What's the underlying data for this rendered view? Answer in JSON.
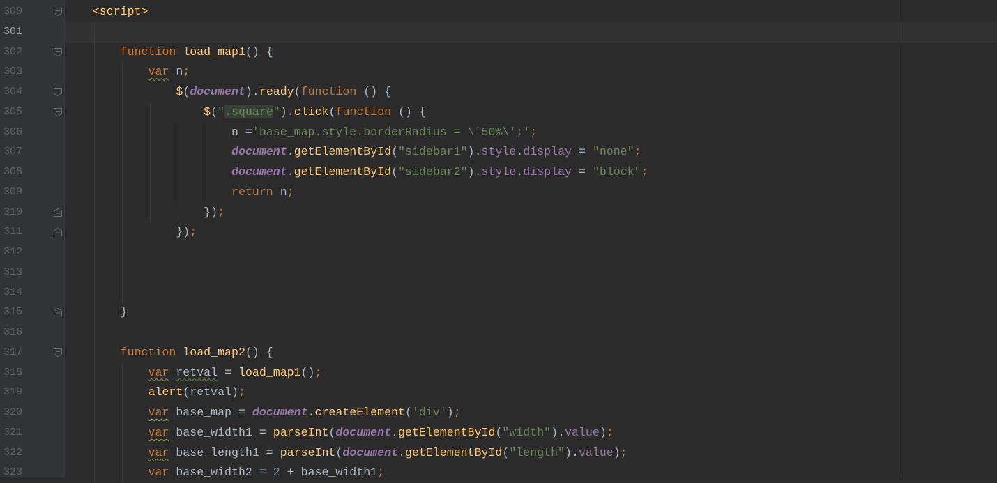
{
  "editor": {
    "current_line": "301",
    "lines": [
      {
        "num": "300",
        "fold": "open",
        "tokens": [
          [
            "t",
            "    "
          ],
          [
            "f",
            "<script>"
          ]
        ]
      },
      {
        "num": "301",
        "fold": "",
        "tokens": []
      },
      {
        "num": "302",
        "fold": "open",
        "tokens": [
          [
            "t",
            "        "
          ],
          [
            "k",
            "function "
          ],
          [
            "f",
            "load_map1"
          ],
          [
            "t",
            "() {"
          ]
        ]
      },
      {
        "num": "303",
        "fold": "",
        "tokens": [
          [
            "t",
            "            "
          ],
          [
            "k w",
            "var"
          ],
          [
            "t",
            " n"
          ],
          [
            "k",
            ";"
          ]
        ]
      },
      {
        "num": "304",
        "fold": "open",
        "tokens": [
          [
            "t",
            "                "
          ],
          [
            "f",
            "$"
          ],
          [
            "t",
            "("
          ],
          [
            "pi",
            "document"
          ],
          [
            "t",
            ")."
          ],
          [
            "f",
            "ready"
          ],
          [
            "t",
            "("
          ],
          [
            "k",
            "function "
          ],
          [
            "t",
            "() {"
          ]
        ]
      },
      {
        "num": "305",
        "fold": "open",
        "tokens": [
          [
            "t",
            "                    "
          ],
          [
            "f",
            "$"
          ],
          [
            "t",
            "("
          ],
          [
            "s",
            "\""
          ],
          [
            "s hl",
            ".square"
          ],
          [
            "s",
            "\""
          ],
          [
            "t",
            ")."
          ],
          [
            "f",
            "click"
          ],
          [
            "t",
            "("
          ],
          [
            "k",
            "function "
          ],
          [
            "t",
            "() {"
          ]
        ]
      },
      {
        "num": "306",
        "fold": "",
        "tokens": [
          [
            "t",
            "                        n ="
          ],
          [
            "s",
            "'base_map.style.borderRadius = \\'50%\\';'"
          ],
          [
            "k",
            ";"
          ]
        ]
      },
      {
        "num": "307",
        "fold": "",
        "tokens": [
          [
            "t",
            "                        "
          ],
          [
            "pi",
            "document"
          ],
          [
            "t",
            "."
          ],
          [
            "f",
            "getElementById"
          ],
          [
            "t",
            "("
          ],
          [
            "s",
            "\"sidebar1\""
          ],
          [
            "t",
            ")."
          ],
          [
            "p",
            "style"
          ],
          [
            "t",
            "."
          ],
          [
            "p",
            "display"
          ],
          [
            "t",
            " = "
          ],
          [
            "s",
            "\"none\""
          ],
          [
            "k",
            ";"
          ]
        ]
      },
      {
        "num": "308",
        "fold": "",
        "tokens": [
          [
            "t",
            "                        "
          ],
          [
            "pi",
            "document"
          ],
          [
            "t",
            "."
          ],
          [
            "f",
            "getElementById"
          ],
          [
            "t",
            "("
          ],
          [
            "s",
            "\"sidebar2\""
          ],
          [
            "t",
            ")."
          ],
          [
            "p",
            "style"
          ],
          [
            "t",
            "."
          ],
          [
            "p",
            "display"
          ],
          [
            "t",
            " = "
          ],
          [
            "s",
            "\"block\""
          ],
          [
            "k",
            ";"
          ]
        ]
      },
      {
        "num": "309",
        "fold": "",
        "tokens": [
          [
            "t",
            "                        "
          ],
          [
            "k",
            "return "
          ],
          [
            "t",
            "n"
          ],
          [
            "k",
            ";"
          ]
        ]
      },
      {
        "num": "310",
        "fold": "close",
        "tokens": [
          [
            "t",
            "                    })"
          ],
          [
            "k",
            ";"
          ]
        ]
      },
      {
        "num": "311",
        "fold": "close",
        "tokens": [
          [
            "t",
            "                })"
          ],
          [
            "k",
            ";"
          ]
        ]
      },
      {
        "num": "312",
        "fold": "",
        "tokens": []
      },
      {
        "num": "313",
        "fold": "",
        "tokens": []
      },
      {
        "num": "314",
        "fold": "",
        "tokens": []
      },
      {
        "num": "315",
        "fold": "close",
        "tokens": [
          [
            "t",
            "        }"
          ]
        ]
      },
      {
        "num": "316",
        "fold": "",
        "tokens": []
      },
      {
        "num": "317",
        "fold": "open",
        "tokens": [
          [
            "t",
            "        "
          ],
          [
            "k",
            "function "
          ],
          [
            "f",
            "load_map2"
          ],
          [
            "t",
            "() {"
          ]
        ]
      },
      {
        "num": "318",
        "fold": "",
        "tokens": [
          [
            "t",
            "            "
          ],
          [
            "k w",
            "var"
          ],
          [
            "t",
            " "
          ],
          [
            "t wg",
            "retval"
          ],
          [
            "t",
            " = "
          ],
          [
            "f",
            "load_map1"
          ],
          [
            "t",
            "()"
          ],
          [
            "k",
            ";"
          ]
        ]
      },
      {
        "num": "319",
        "fold": "",
        "tokens": [
          [
            "t",
            "            "
          ],
          [
            "f",
            "alert"
          ],
          [
            "t",
            "(retval)"
          ],
          [
            "k",
            ";"
          ]
        ]
      },
      {
        "num": "320",
        "fold": "",
        "tokens": [
          [
            "t",
            "            "
          ],
          [
            "k w",
            "var"
          ],
          [
            "t",
            " base_map = "
          ],
          [
            "pi",
            "document"
          ],
          [
            "t",
            "."
          ],
          [
            "f",
            "createElement"
          ],
          [
            "t",
            "("
          ],
          [
            "s",
            "'div'"
          ],
          [
            "t",
            ")"
          ],
          [
            "k",
            ";"
          ]
        ]
      },
      {
        "num": "321",
        "fold": "",
        "tokens": [
          [
            "t",
            "            "
          ],
          [
            "k w",
            "var"
          ],
          [
            "t",
            " base_width1 = "
          ],
          [
            "f",
            "parseInt"
          ],
          [
            "t",
            "("
          ],
          [
            "pi",
            "document"
          ],
          [
            "t",
            "."
          ],
          [
            "f",
            "getElementById"
          ],
          [
            "t",
            "("
          ],
          [
            "s",
            "\"width\""
          ],
          [
            "t",
            ")."
          ],
          [
            "p",
            "value"
          ],
          [
            "t",
            ")"
          ],
          [
            "k",
            ";"
          ]
        ]
      },
      {
        "num": "322",
        "fold": "",
        "tokens": [
          [
            "t",
            "            "
          ],
          [
            "k w",
            "var"
          ],
          [
            "t",
            " base_length1 = "
          ],
          [
            "f",
            "parseInt"
          ],
          [
            "t",
            "("
          ],
          [
            "pi",
            "document"
          ],
          [
            "t",
            "."
          ],
          [
            "f",
            "getElementById"
          ],
          [
            "t",
            "("
          ],
          [
            "s",
            "\"length\""
          ],
          [
            "t",
            ")."
          ],
          [
            "p",
            "value"
          ],
          [
            "t",
            ")"
          ],
          [
            "k",
            ";"
          ]
        ]
      },
      {
        "num": "323",
        "fold": "",
        "tokens": [
          [
            "t",
            "            "
          ],
          [
            "k",
            "var"
          ],
          [
            "t",
            " base_width2 = "
          ],
          [
            "n",
            "2"
          ],
          [
            "t",
            " + base_width1"
          ],
          [
            "k",
            ";"
          ]
        ]
      }
    ]
  }
}
